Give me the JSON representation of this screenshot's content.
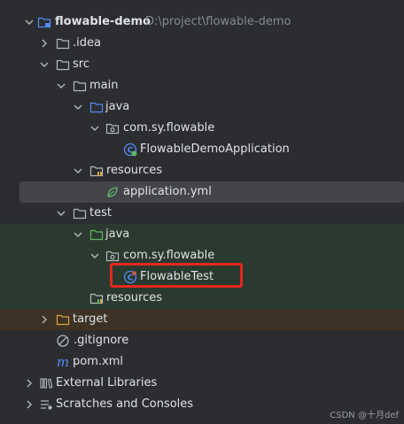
{
  "tree": {
    "project": {
      "name": "flowable-demo",
      "path": "D:\\project\\flowable-demo"
    },
    "idea": ".idea",
    "src": "src",
    "main": "main",
    "main_java": "java",
    "main_package": "com.sy.flowable",
    "main_class": "FlowableDemoApplication",
    "main_resources": "resources",
    "app_yml": "application.yml",
    "test": "test",
    "test_java": "java",
    "test_package": "com.sy.flowable",
    "test_class": "FlowableTest",
    "test_resources": "resources",
    "target": "target",
    "gitignore": ".gitignore",
    "pom": "pom.xml",
    "external_libraries": "External Libraries",
    "scratches": "Scratches and Consoles"
  },
  "watermark": "CSDN @十月def",
  "colors": {
    "background": "#2b2d30",
    "selected_row": "#43454a",
    "test_rows": "#2b3a2f",
    "excluded_row": "#3d3223",
    "highlight_box": "#e5271d",
    "folder_blue": "#548af7",
    "folder_green": "#5fb865",
    "folder_orange": "#d9a343"
  }
}
